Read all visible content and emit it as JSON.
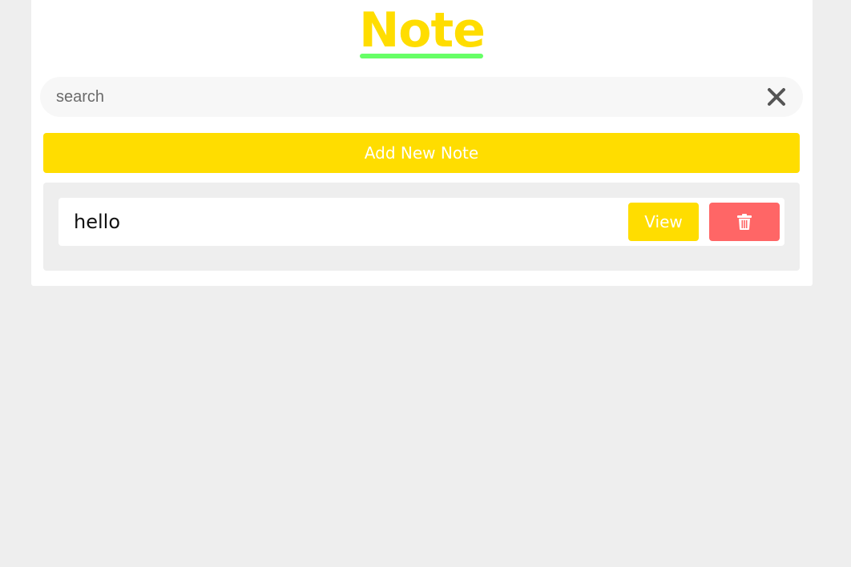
{
  "header": {
    "title": "Note"
  },
  "search": {
    "placeholder": "search",
    "value": "",
    "clear_icon": "close-icon"
  },
  "actions": {
    "add_label": "Add New Note"
  },
  "notes": [
    {
      "title": "hello",
      "view_label": "View",
      "delete_icon": "trash-icon"
    }
  ],
  "colors": {
    "accent_yellow": "#ffdd00",
    "underline_green": "#66ff66",
    "delete_red": "#ff6666",
    "page_background": "#eeeeee"
  }
}
